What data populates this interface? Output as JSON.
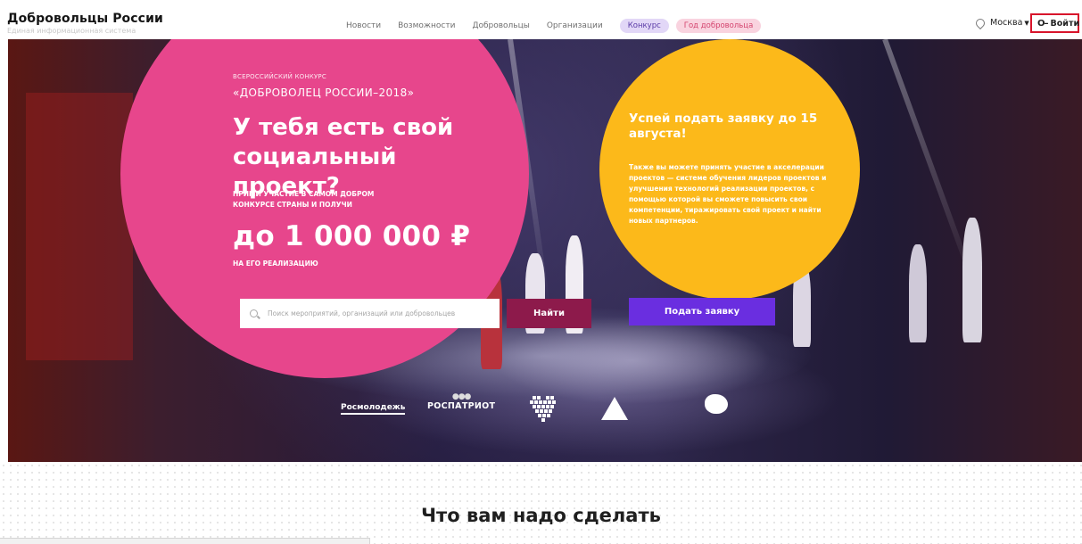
{
  "header": {
    "logo_title": "Добровольцы России",
    "logo_subtitle": "Единая информационная система",
    "nav": [
      "Новости",
      "Возможности",
      "Добровольцы",
      "Организации"
    ],
    "pill_contest": "Конкурс",
    "pill_year": "Год добровольца",
    "city": "Москва",
    "login_label": "Войти"
  },
  "hero": {
    "kicker": "ВСЕРОССИЙСКИЙ КОНКУРС",
    "contest_name": "«ДОБРОВОЛЕЦ РОССИИ–2018»",
    "headline": "У тебя есть свой социальный проект?",
    "call": "ПРИМИ УЧАСТИЕ В САМОМ ДОБРОМ КОНКУРСЕ СТРАНЫ И ПОЛУЧИ",
    "prize": "до 1 000 000 ₽",
    "prize_note": "НА ЕГО РЕАЛИЗАЦИЮ",
    "deadline_title": "Успей подать заявку до 15 августа!",
    "deadline_text": "Также вы можете принять участие в акселерации проектов — системе обучения лидеров проектов и улучшения технологий реализации проектов, с помощью которой вы сможете повысить свои компетенции, тиражировать свой проект и найти новых партнеров.",
    "search_placeholder": "Поиск мероприятий, организаций или добровольцев",
    "find_button": "Найти",
    "apply_button": "Подать заявку",
    "partners": {
      "rosmolodezh": "Росмолодежь",
      "rospatriot": "РОСПАТРИОТ"
    }
  },
  "section": {
    "title": "Что вам надо сделать"
  },
  "colors": {
    "pink": "#e7468c",
    "yellow": "#fcb91a",
    "find_button": "#8d1a4b",
    "apply_button": "#6a2ee0",
    "login_outline": "#d8142b"
  }
}
